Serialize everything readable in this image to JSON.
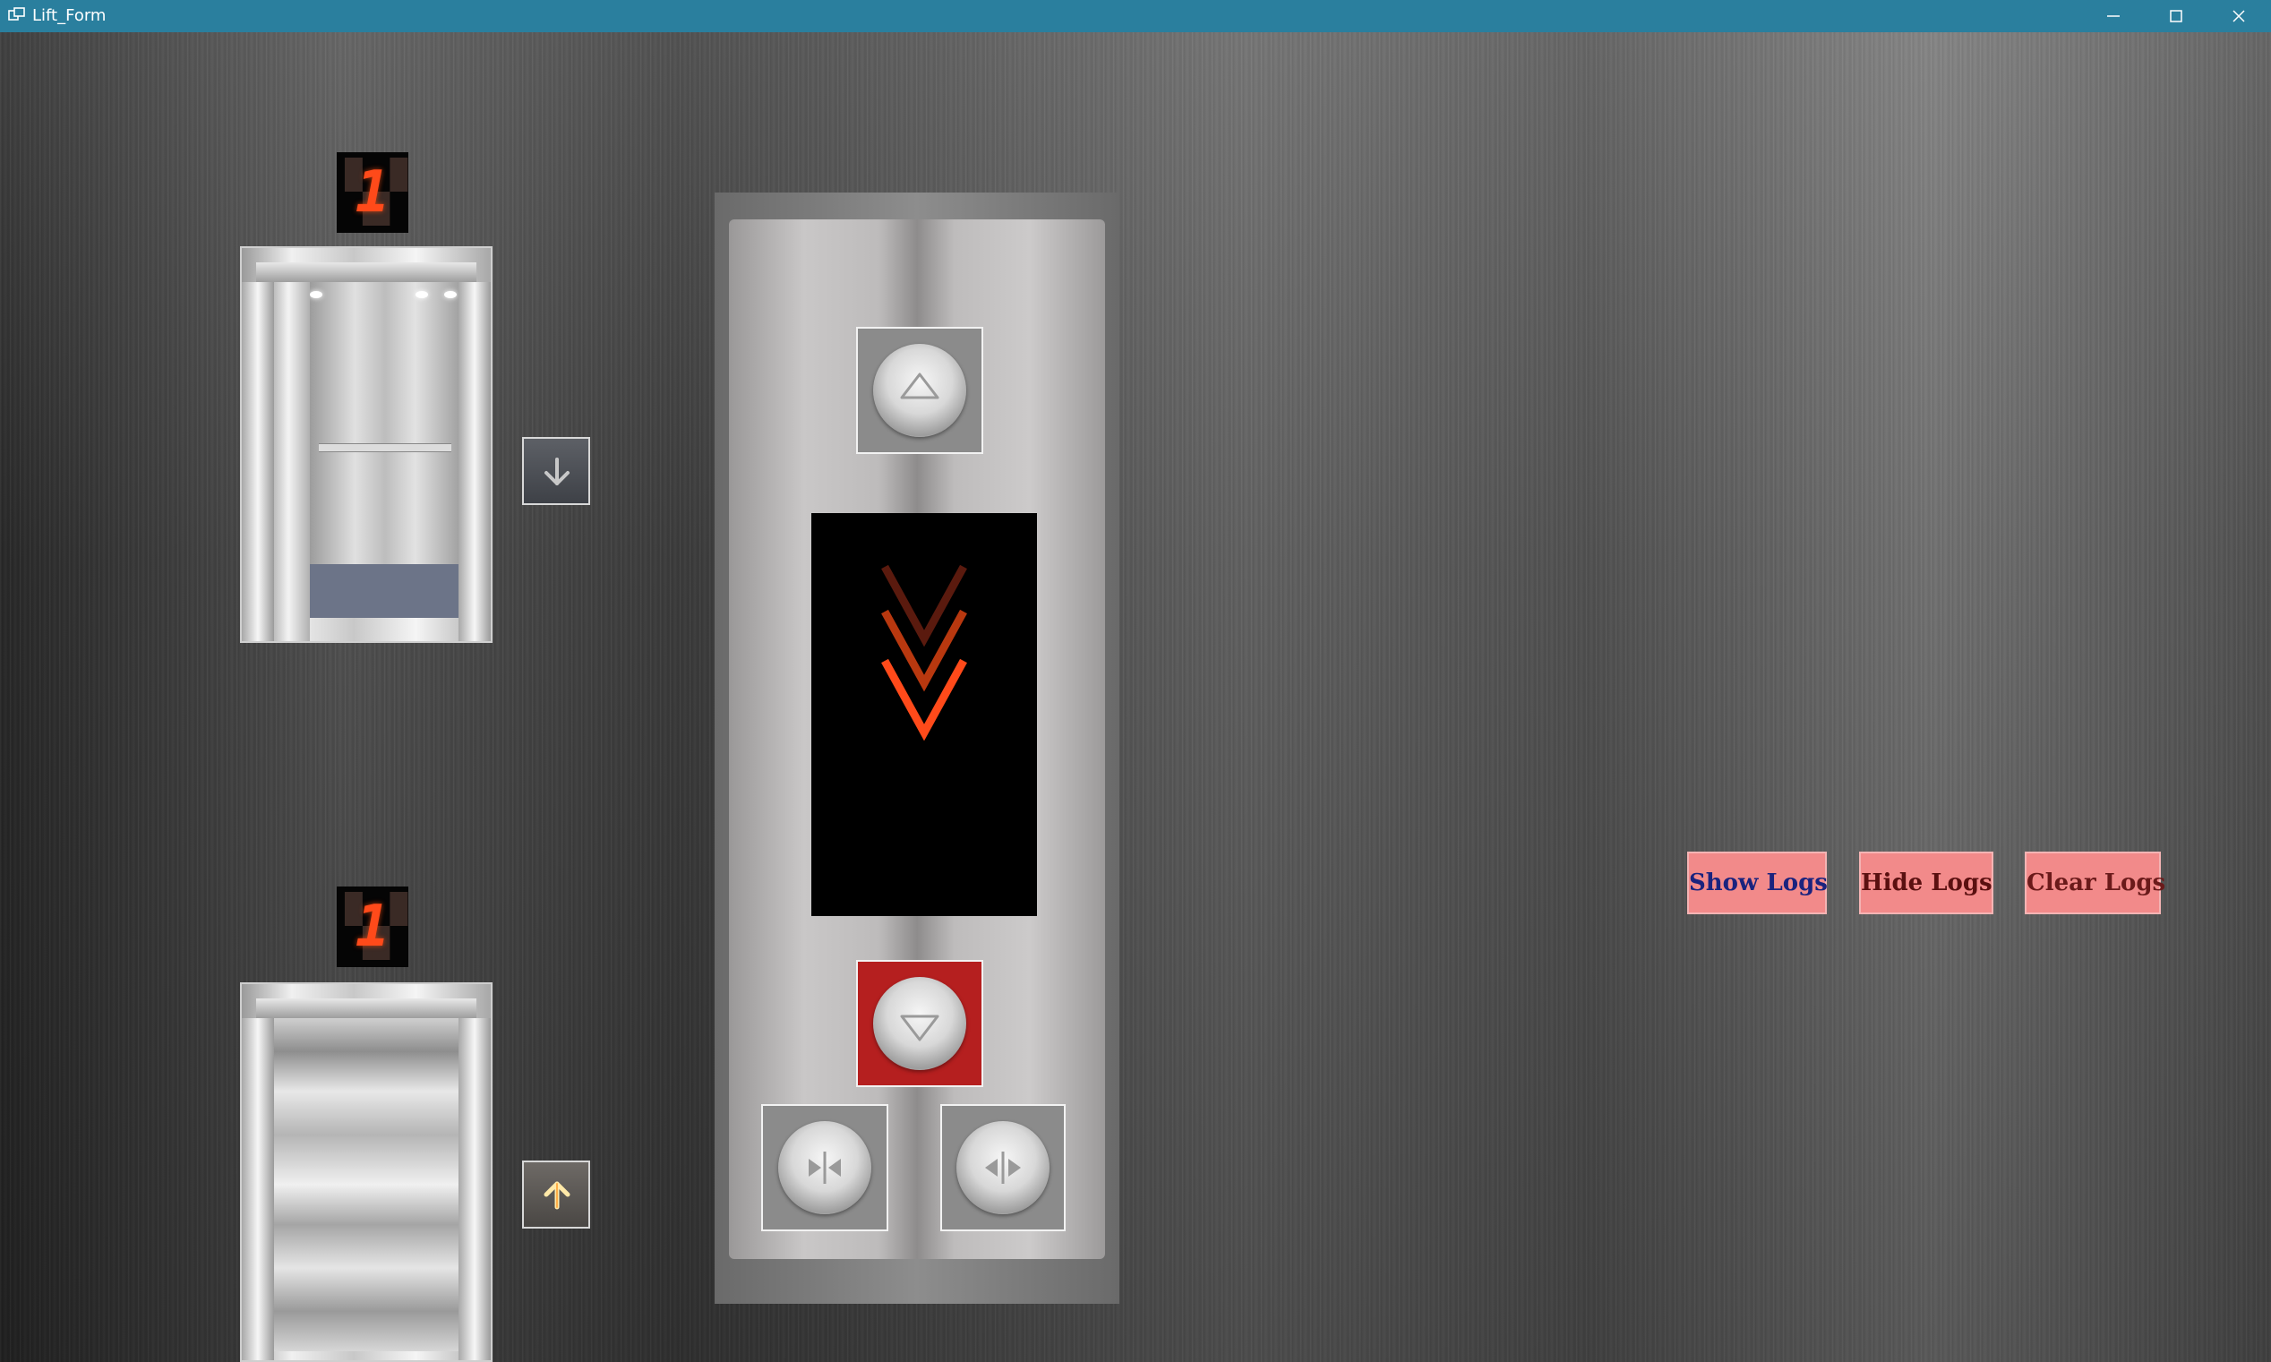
{
  "window": {
    "title": "Lift_Form"
  },
  "colors": {
    "titlebar": "#2a7f9e",
    "arrow_active": "#ff4a1a",
    "panel_active_button": "#b51f1f",
    "log_button_bg": "#f28a8a",
    "show_logs_text": "#1a237e",
    "hide_logs_text": "#5a1010",
    "clear_logs_text": "#6a1a1a"
  },
  "lifts": [
    {
      "floor_display": "1",
      "door_state": "open",
      "call_button": {
        "icon": "arrow-down-icon",
        "active": false
      }
    },
    {
      "floor_display": "1",
      "door_state": "closed",
      "call_button": {
        "icon": "arrow-up-icon",
        "active": true
      }
    }
  ],
  "panel": {
    "up_button": {
      "icon": "triangle-up-icon",
      "active": false
    },
    "down_button": {
      "icon": "triangle-down-icon",
      "active": true
    },
    "door_close_button": {
      "icon": "doors-close-icon"
    },
    "door_open_button": {
      "icon": "doors-open-icon"
    },
    "direction_display": {
      "direction": "down",
      "icon": "chevron-down-icon"
    }
  },
  "log_buttons": {
    "show": "Show Logs",
    "hide": "Hide Logs",
    "clear": "Clear Logs"
  }
}
